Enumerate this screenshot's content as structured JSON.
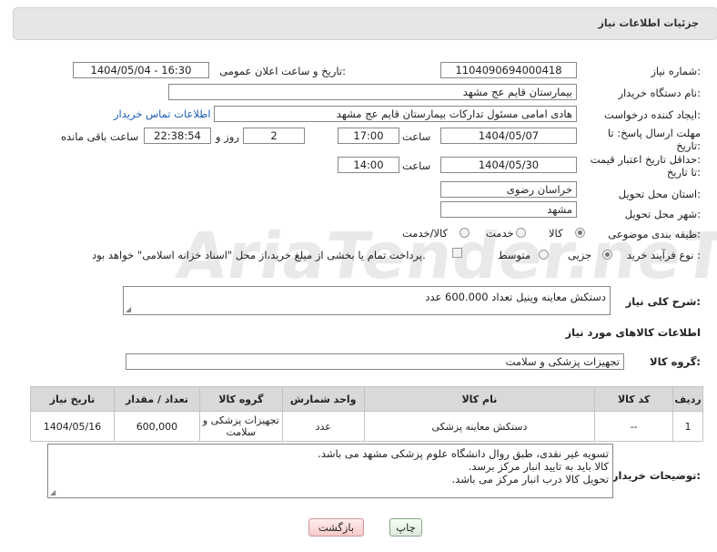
{
  "header": {
    "title": "جزئیات اطلاعات نیاز"
  },
  "form": {
    "need_number_label": "شماره نیاز:",
    "need_number": "1104090694000418",
    "announce_label": "تاریخ و ساعت اعلان عمومی:",
    "announce_value": "1404/05/04 - 16:30",
    "buyer_label": "نام دستگاه خریدار:",
    "buyer": "بیمارستان قایم  عج  مشهد",
    "creator_label": "ایجاد کننده درخواست:",
    "creator": "هادی امامی مسئول تدارکات بیمارستان قایم  عج  مشهد",
    "contact_link": "اطلاعات تماس خریدار",
    "deadline_label_1": "مهلت ارسال پاسخ: تا",
    "deadline_label_2": "تاریخ:",
    "deadline_date": "1404/05/07",
    "time_label": "ساعت",
    "deadline_time": "17:00",
    "days_value": "2",
    "days_label": "روز و",
    "remaining_time": "22:38:54",
    "remaining_label": "ساعت باقی مانده",
    "validity_label_1": "حداقل تاریخ اعتبار قیمت:",
    "validity_label_2": "تا تاریخ:",
    "validity_date": "1404/05/30",
    "validity_time": "14:00",
    "province_label": "استان محل تحویل:",
    "province": "خراسان رضوی",
    "city_label": "شهر محل تحویل:",
    "city": "مشهد",
    "category_label": "طبقه بندی موضوعی:",
    "category_options": [
      "کالا",
      "خدمت",
      "کالا/خدمت"
    ],
    "process_label": "نوع فرآیند خرید :",
    "process_options": [
      "جزیی",
      "متوسط"
    ],
    "payment_note": "پرداخت تمام یا بخشی از مبلغ خرید،از محل \"اسناد خزانه اسلامی\" خواهد بود.",
    "summary_label": "شرح کلی نیاز:",
    "summary": "دستکش معاینه وینیل تعداد 600.000 عدد",
    "goods_info_title": "اطلاعات کالاهای مورد نیاز",
    "goods_group_label": "گروه کالا:",
    "goods_group": "تجهیزات پزشکی و سلامت"
  },
  "table": {
    "headers": [
      "ردیف",
      "کد کالا",
      "نام کالا",
      "واحد شمارش",
      "گروه کالا",
      "تعداد / مقدار",
      "تاریخ نیاز"
    ],
    "rows": [
      [
        "1",
        "--",
        "دستکش معاینه پزشکی",
        "عدد",
        "تجهیزات پزشکی و سلامت",
        "600,000",
        "1404/05/16"
      ]
    ]
  },
  "buyer_notes": {
    "label": "توضیحات خریدار:",
    "lines": [
      "تسویه غیر نقدی، طبق روال دانشگاه علوم پزشکی مشهد می باشد.",
      "کالا باید به تایید انبار مرکز برسد.",
      "تحویل کالا درب انبار مرکز می باشد."
    ]
  },
  "buttons": {
    "print": "چاپ",
    "back": "بازگشت"
  },
  "watermark": "AriaTender.neT"
}
